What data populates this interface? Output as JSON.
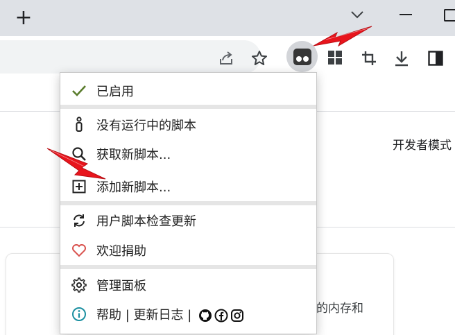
{
  "browser": {
    "new_tab_symbol": "+",
    "icons": [
      "chevron-down-icon",
      "minimize-icon",
      "restore-icon",
      "share-icon",
      "star-icon",
      "tampermonkey-icon",
      "extensions-icon",
      "crop-icon",
      "download-icon",
      "side-panel-icon"
    ]
  },
  "menu": {
    "enabled_label": "已启用",
    "no_running_label": "没有运行中的脚本",
    "get_new_label": "获取新脚本...",
    "add_new_label": "添加新脚本...",
    "check_updates_label": "用户脚本检查更新",
    "donate_label": "欢迎捐助",
    "dashboard_label": "管理面板",
    "help_label": "帮助 | 更新日志 |"
  },
  "page": {
    "developer_mode": "开发者模式",
    "card_text": "的内存和"
  },
  "colors": {
    "check_green": "#5a7c2c",
    "heart_red": "#d9534f",
    "info_teal": "#1a8fa0",
    "annotation_red": "#e8141c"
  }
}
